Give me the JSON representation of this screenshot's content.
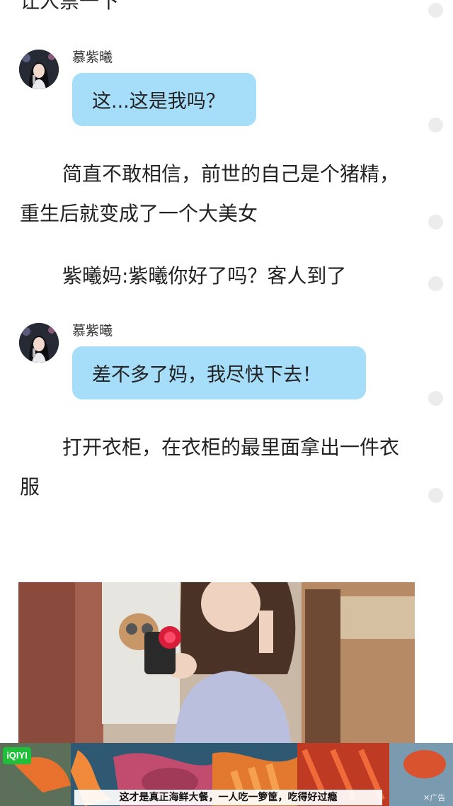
{
  "story": {
    "top_partial": "让人禁一下",
    "para1": "简直不敢相信，前世的自己是个猪精，重生后就变成了一个大美女",
    "para2": "紫曦妈:紫曦你好了吗？客人到了",
    "para3": "打开衣柜，在衣柜的最里面拿出一件衣服"
  },
  "messages": [
    {
      "sender": "慕紫曦",
      "text": "这...这是我吗？",
      "avatar_icon": "avatar-girl-microphone"
    },
    {
      "sender": "慕紫曦",
      "text": "差不多了妈，我尽快下去！",
      "avatar_icon": "avatar-girl-microphone"
    }
  ],
  "ad": {
    "logo": "iQIYI",
    "caption": "这才是真正海鲜大餐，一人吃一箩筐，吃得好过瘾",
    "tag": "广告"
  },
  "colors": {
    "bubble": "#a6defa",
    "rail_dot": "#ececec",
    "brand_green": "#1fbf3a"
  }
}
